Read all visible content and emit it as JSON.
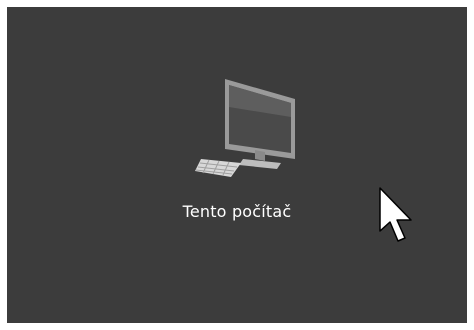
{
  "desktop": {
    "icons": [
      {
        "label": "Tento počítač",
        "icon": "computer-icon"
      }
    ]
  },
  "cursor": {
    "icon": "mouse-pointer-icon"
  },
  "colors": {
    "desktop_background": "#3c3c3c",
    "label_text": "#ffffff"
  }
}
